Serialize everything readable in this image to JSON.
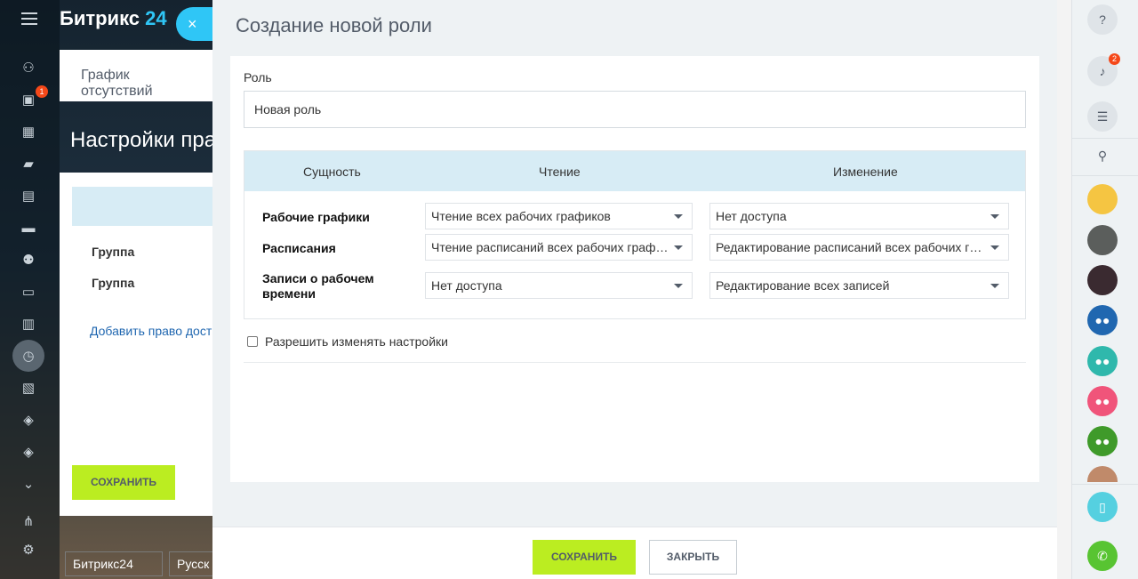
{
  "app": {
    "logo_text": "Битрикс",
    "logo_num": "24",
    "menu_badge": "1"
  },
  "background": {
    "tab_label": "График отсутствий",
    "page_title": "Настройки пра",
    "group_1": "Группа",
    "group_2": "Группа",
    "add_right": "Добавить право дост",
    "save_label": "СОХРАНИТЬ",
    "footer_logo": "Битрикс24",
    "footer_lang": "Русск"
  },
  "slider": {
    "close_glyph": "×",
    "title": "Создание новой роли",
    "role_label": "Роль",
    "role_value": "Новая роль",
    "headers": {
      "entity": "Сущность",
      "read": "Чтение",
      "edit": "Изменение"
    },
    "rows": [
      {
        "entity": "Рабочие графики",
        "read": "Чтение всех рабочих графиков",
        "edit": "Нет доступа"
      },
      {
        "entity": "Расписания",
        "read": "Чтение расписаний всех рабочих граф…",
        "edit": "Редактирование расписаний всех рабочих гр…"
      },
      {
        "entity": "Записи о рабочем времени",
        "read": "Нет доступа",
        "edit": "Редактирование всех записей"
      }
    ],
    "checkbox_label": "Разрешить изменять настройки",
    "save_label": "СОХРАНИТЬ",
    "close_label": "ЗАКРЫТЬ"
  },
  "rightbar": {
    "notif_badge": "2",
    "colors": {
      "chat1": "#2067b0",
      "group1": "#2fb8ac",
      "group2": "#f0547a",
      "group3": "#3f9a2a",
      "drive": "#55d0e0",
      "call": "#58c432"
    }
  },
  "colors": {
    "accent_green": "#bbed21",
    "accent_blue": "#2fc6f6",
    "table_head": "#d7ecf5"
  }
}
